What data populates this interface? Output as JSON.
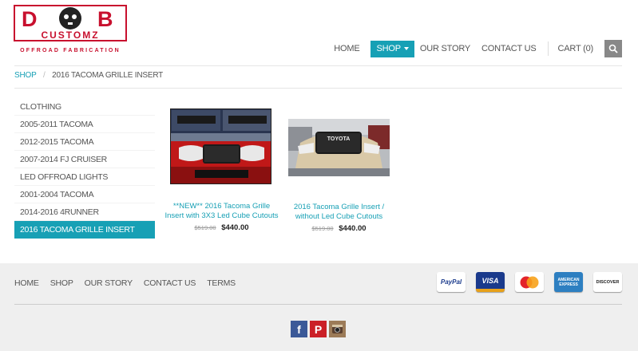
{
  "brand": {
    "logo_letters": "DOB",
    "logo_word": "CUSTOMZ",
    "tagline": "OFFROAD FABRICATION"
  },
  "nav": {
    "home": "HOME",
    "shop": "SHOP",
    "our_story": "OUR STORY",
    "contact_us": "CONTACT US",
    "cart": "CART (0)"
  },
  "breadcrumb": {
    "root": "SHOP",
    "separator": "/",
    "current": "2016 TACOMA GRILLE INSERT"
  },
  "sidebar": {
    "items": [
      {
        "label": "CLOTHING"
      },
      {
        "label": "2005-2011 TACOMA"
      },
      {
        "label": "2012-2015 TACOMA"
      },
      {
        "label": "2007-2014 FJ CRUISER"
      },
      {
        "label": "LED OFFROAD LIGHTS"
      },
      {
        "label": "2001-2004 TACOMA"
      },
      {
        "label": "2014-2016 4RUNNER"
      },
      {
        "label": "2016 TACOMA GRILLE INSERT"
      }
    ]
  },
  "products": [
    {
      "title": "**NEW** 2016 Tacoma Grille Insert with 3X3 Led Cube Cutouts",
      "old_price": "$519.00",
      "price": "$440.00"
    },
    {
      "title": "2016 Tacoma Grille Insert / without Led Cube Cutouts",
      "old_price": "$519.00",
      "price": "$440.00"
    }
  ],
  "footer": {
    "links": [
      "HOME",
      "SHOP",
      "OUR STORY",
      "CONTACT US",
      "TERMS"
    ],
    "payment": {
      "paypal": "PayPal",
      "visa": "VISA",
      "mastercard": "MasterCard",
      "amex": "AMERICAN EXPRESS",
      "discover": "DISCOVER"
    },
    "social_icons": [
      "facebook-icon",
      "pinterest-icon",
      "instagram-icon"
    ]
  },
  "colors": {
    "accent": "#17a0b5",
    "brand_red": "#c8102e",
    "footer_bg": "#efefef"
  }
}
